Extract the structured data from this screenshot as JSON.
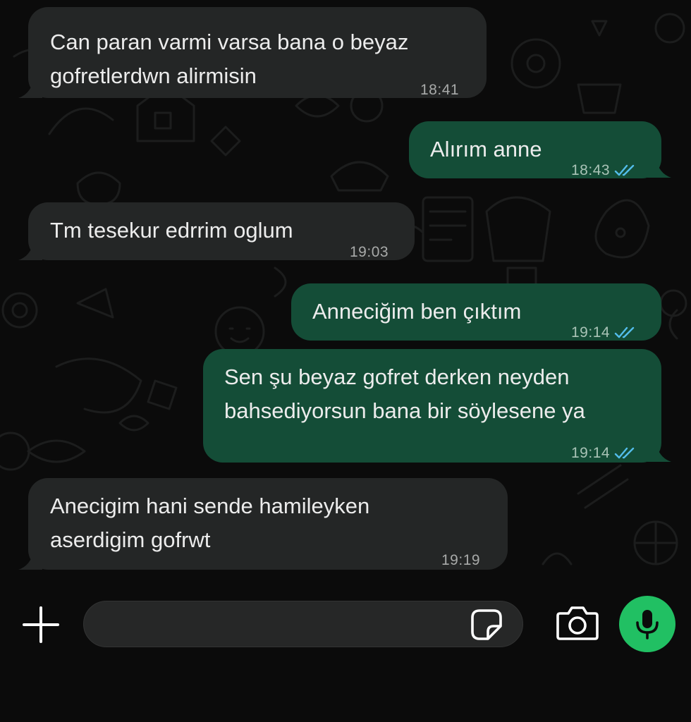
{
  "colors": {
    "background": "#0b0b0b",
    "incoming_bubble": "#242626",
    "outgoing_bubble": "#144d37",
    "message_text": "#ececec",
    "read_receipt": "#53bdeb",
    "mic_button": "#21c063"
  },
  "messages": [
    {
      "direction": "incoming",
      "lines": [
        "Can paran varmi varsa bana o beyaz",
        "gofretlerdwn alirmisin"
      ],
      "time": "18:41"
    },
    {
      "direction": "outgoing",
      "lines": [
        "Alırım anne"
      ],
      "time": "18:43",
      "status_icon": "double-check-read-icon"
    },
    {
      "direction": "incoming",
      "lines": [
        "Tm tesekur edrrim oglum"
      ],
      "time": "19:03"
    },
    {
      "direction": "outgoing",
      "lines": [
        "Anneciğim ben çıktım"
      ],
      "time": "19:14",
      "status_icon": "double-check-read-icon"
    },
    {
      "direction": "outgoing",
      "lines": [
        "Sen şu beyaz gofret derken neyden",
        "bahsediyorsun bana bir söylesene ya"
      ],
      "time": "19:14",
      "status_icon": "double-check-read-icon"
    },
    {
      "direction": "incoming",
      "lines": [
        "Anecigim hani sende hamileyken",
        "aserdigim gofrwt"
      ],
      "time": "19:19"
    }
  ],
  "composer": {
    "attach_icon": "plus-icon",
    "input_value": "",
    "sticker_icon": "sticker-icon",
    "camera_icon": "camera-icon",
    "mic_icon": "microphone-icon"
  }
}
